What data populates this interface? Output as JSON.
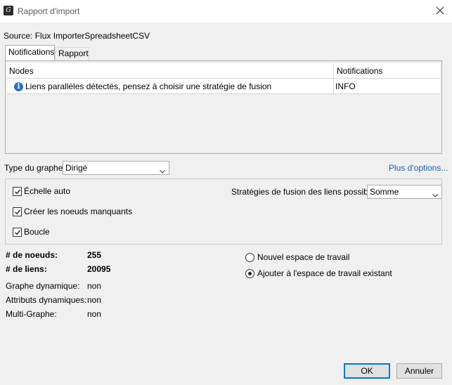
{
  "window": {
    "title": "Rapport d'import",
    "app_icon": "gephi-app-icon"
  },
  "source": {
    "label": "Source:",
    "value": "Flux ImporterSpreadsheetCSV"
  },
  "tabs": [
    {
      "label": "Notifications",
      "active": true
    },
    {
      "label": "Rapport",
      "active": false
    }
  ],
  "table": {
    "columns": [
      "Nodes",
      "Notifications"
    ],
    "rows": [
      {
        "icon": "info-icon",
        "message": "Liens parallèles détectés, pensez à choisir une stratégie de fusion",
        "level": "INFO"
      }
    ]
  },
  "graph_type": {
    "label": "Type du graphe:",
    "value": "Dirigé"
  },
  "more_options": "Plus d'options...",
  "checkboxes": [
    {
      "label": "Échelle auto",
      "checked": true
    },
    {
      "label": "Créer les noeuds manquants",
      "checked": true
    },
    {
      "label": "Boucle",
      "checked": true
    }
  ],
  "merge_strategy": {
    "label": "Stratégies de fusion des liens possibles :",
    "value": "Somme"
  },
  "stats": {
    "nodes_label": "# de noeuds:",
    "nodes_value": "255",
    "edges_label": "# de liens:",
    "edges_value": "20095",
    "dynamic_graph_label": "Graphe dynamique:",
    "dynamic_graph_value": "non",
    "dynamic_attrs_label": "Attributs dynamiques:",
    "dynamic_attrs_value": "non",
    "multigraph_label": "Multi-Graphe:",
    "multigraph_value": "non"
  },
  "workspace": {
    "new_label": "Nouvel espace de travail",
    "append_label": "Ajouter à l'espace de travail existant",
    "selected": "append"
  },
  "buttons": {
    "ok": "OK",
    "cancel": "Annuler"
  },
  "colors": {
    "accent": "#0078d7",
    "link": "#2259b2",
    "info": "#2f6fc4"
  }
}
